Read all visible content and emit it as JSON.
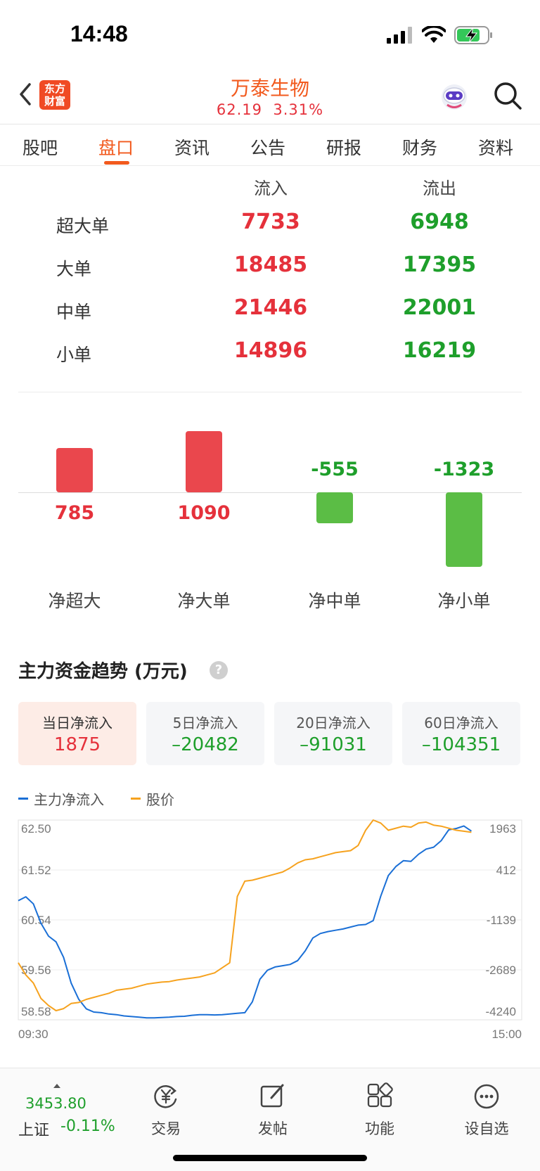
{
  "status": {
    "time": "14:48"
  },
  "header": {
    "logo_line1": "东方",
    "logo_line2": "财富",
    "stock_name": "万泰生物",
    "price": "62.19",
    "change_pct": "3.31%"
  },
  "tabs": [
    {
      "label": "股吧",
      "active": false
    },
    {
      "label": "盘口",
      "active": true
    },
    {
      "label": "资讯",
      "active": false
    },
    {
      "label": "公告",
      "active": false
    },
    {
      "label": "研报",
      "active": false
    },
    {
      "label": "财务",
      "active": false
    },
    {
      "label": "资料",
      "active": false
    }
  ],
  "flow_table": {
    "col_in": "流入",
    "col_out": "流出",
    "rows": [
      {
        "label": "超大单",
        "in": "7733",
        "out": "6948"
      },
      {
        "label": "大单",
        "in": "18485",
        "out": "17395"
      },
      {
        "label": "中单",
        "in": "21446",
        "out": "22001"
      },
      {
        "label": "小单",
        "in": "14896",
        "out": "16219"
      }
    ]
  },
  "net_bars": [
    {
      "label": "净超大",
      "value": 785,
      "value_text": "785"
    },
    {
      "label": "净大单",
      "value": 1090,
      "value_text": "1090"
    },
    {
      "label": "净中单",
      "value": -555,
      "value_text": "-555"
    },
    {
      "label": "净小单",
      "value": -1323,
      "value_text": "-1323"
    }
  ],
  "trend": {
    "title": "主力资金趋势 (万元)",
    "help": "?",
    "cards": [
      {
        "label": "当日净流入",
        "value": "1875",
        "active": true
      },
      {
        "label": "5日净流入",
        "value": "–20482",
        "active": false
      },
      {
        "label": "20日净流入",
        "value": "–91031",
        "active": false
      },
      {
        "label": "60日净流入",
        "value": "–104351",
        "active": false
      }
    ],
    "legend": [
      {
        "label": "主力净流入",
        "color": "#1a6fd6"
      },
      {
        "label": "股价",
        "color": "#f6a21e"
      }
    ]
  },
  "chart_data": {
    "type": "line",
    "x_start": "09:30",
    "x_end": "15:00",
    "y_left_ticks": [
      "62.50",
      "61.52",
      "60.54",
      "59.56",
      "58.58"
    ],
    "y_right_ticks": [
      "1963",
      "412",
      "-1139",
      "-2689",
      "-4240"
    ],
    "y_left_lim": [
      58.58,
      62.5
    ],
    "y_right_lim": [
      -4240,
      1963
    ],
    "grid": true,
    "series": [
      {
        "name": "主力净流入",
        "color": "#1a6fd6",
        "axis": "right",
        "values": [
          -540,
          -420,
          -640,
          -1240,
          -1640,
          -1820,
          -2300,
          -3100,
          -3600,
          -3900,
          -4000,
          -4020,
          -4060,
          -4080,
          -4120,
          -4140,
          -4160,
          -4180,
          -4180,
          -4170,
          -4160,
          -4140,
          -4130,
          -4100,
          -4080,
          -4080,
          -4090,
          -4080,
          -4060,
          -4040,
          -4020,
          -3680,
          -2980,
          -2700,
          -2600,
          -2560,
          -2520,
          -2400,
          -2100,
          -1700,
          -1560,
          -1500,
          -1460,
          -1420,
          -1360,
          -1300,
          -1280,
          -1160,
          -400,
          240,
          520,
          700,
          680,
          900,
          1060,
          1120,
          1320,
          1660,
          1700,
          1780,
          1620
        ]
      },
      {
        "name": "股价",
        "color": "#f6a21e",
        "axis": "left",
        "values": [
          59.7,
          59.46,
          59.3,
          59.0,
          58.86,
          58.76,
          58.8,
          58.9,
          58.92,
          58.98,
          59.02,
          59.06,
          59.1,
          59.16,
          59.18,
          59.2,
          59.24,
          59.28,
          59.3,
          59.32,
          59.33,
          59.36,
          59.38,
          59.4,
          59.42,
          59.46,
          59.5,
          59.6,
          59.7,
          61.0,
          61.3,
          61.32,
          61.36,
          61.4,
          61.44,
          61.48,
          61.56,
          61.66,
          61.72,
          61.74,
          61.78,
          61.82,
          61.86,
          61.88,
          61.9,
          62.0,
          62.3,
          62.5,
          62.44,
          62.3,
          62.34,
          62.38,
          62.36,
          62.44,
          62.46,
          62.4,
          62.38,
          62.34,
          62.3,
          62.28,
          62.26
        ]
      }
    ]
  },
  "bottom_nav": {
    "index_value": "3453.80",
    "index_name": "上证",
    "index_change": "-0.11%",
    "items": [
      {
        "label": "交易",
        "icon": "yen-cycle-icon"
      },
      {
        "label": "发帖",
        "icon": "edit-icon"
      },
      {
        "label": "功能",
        "icon": "grid-icon"
      },
      {
        "label": "设自选",
        "icon": "more-dots-icon"
      }
    ]
  }
}
